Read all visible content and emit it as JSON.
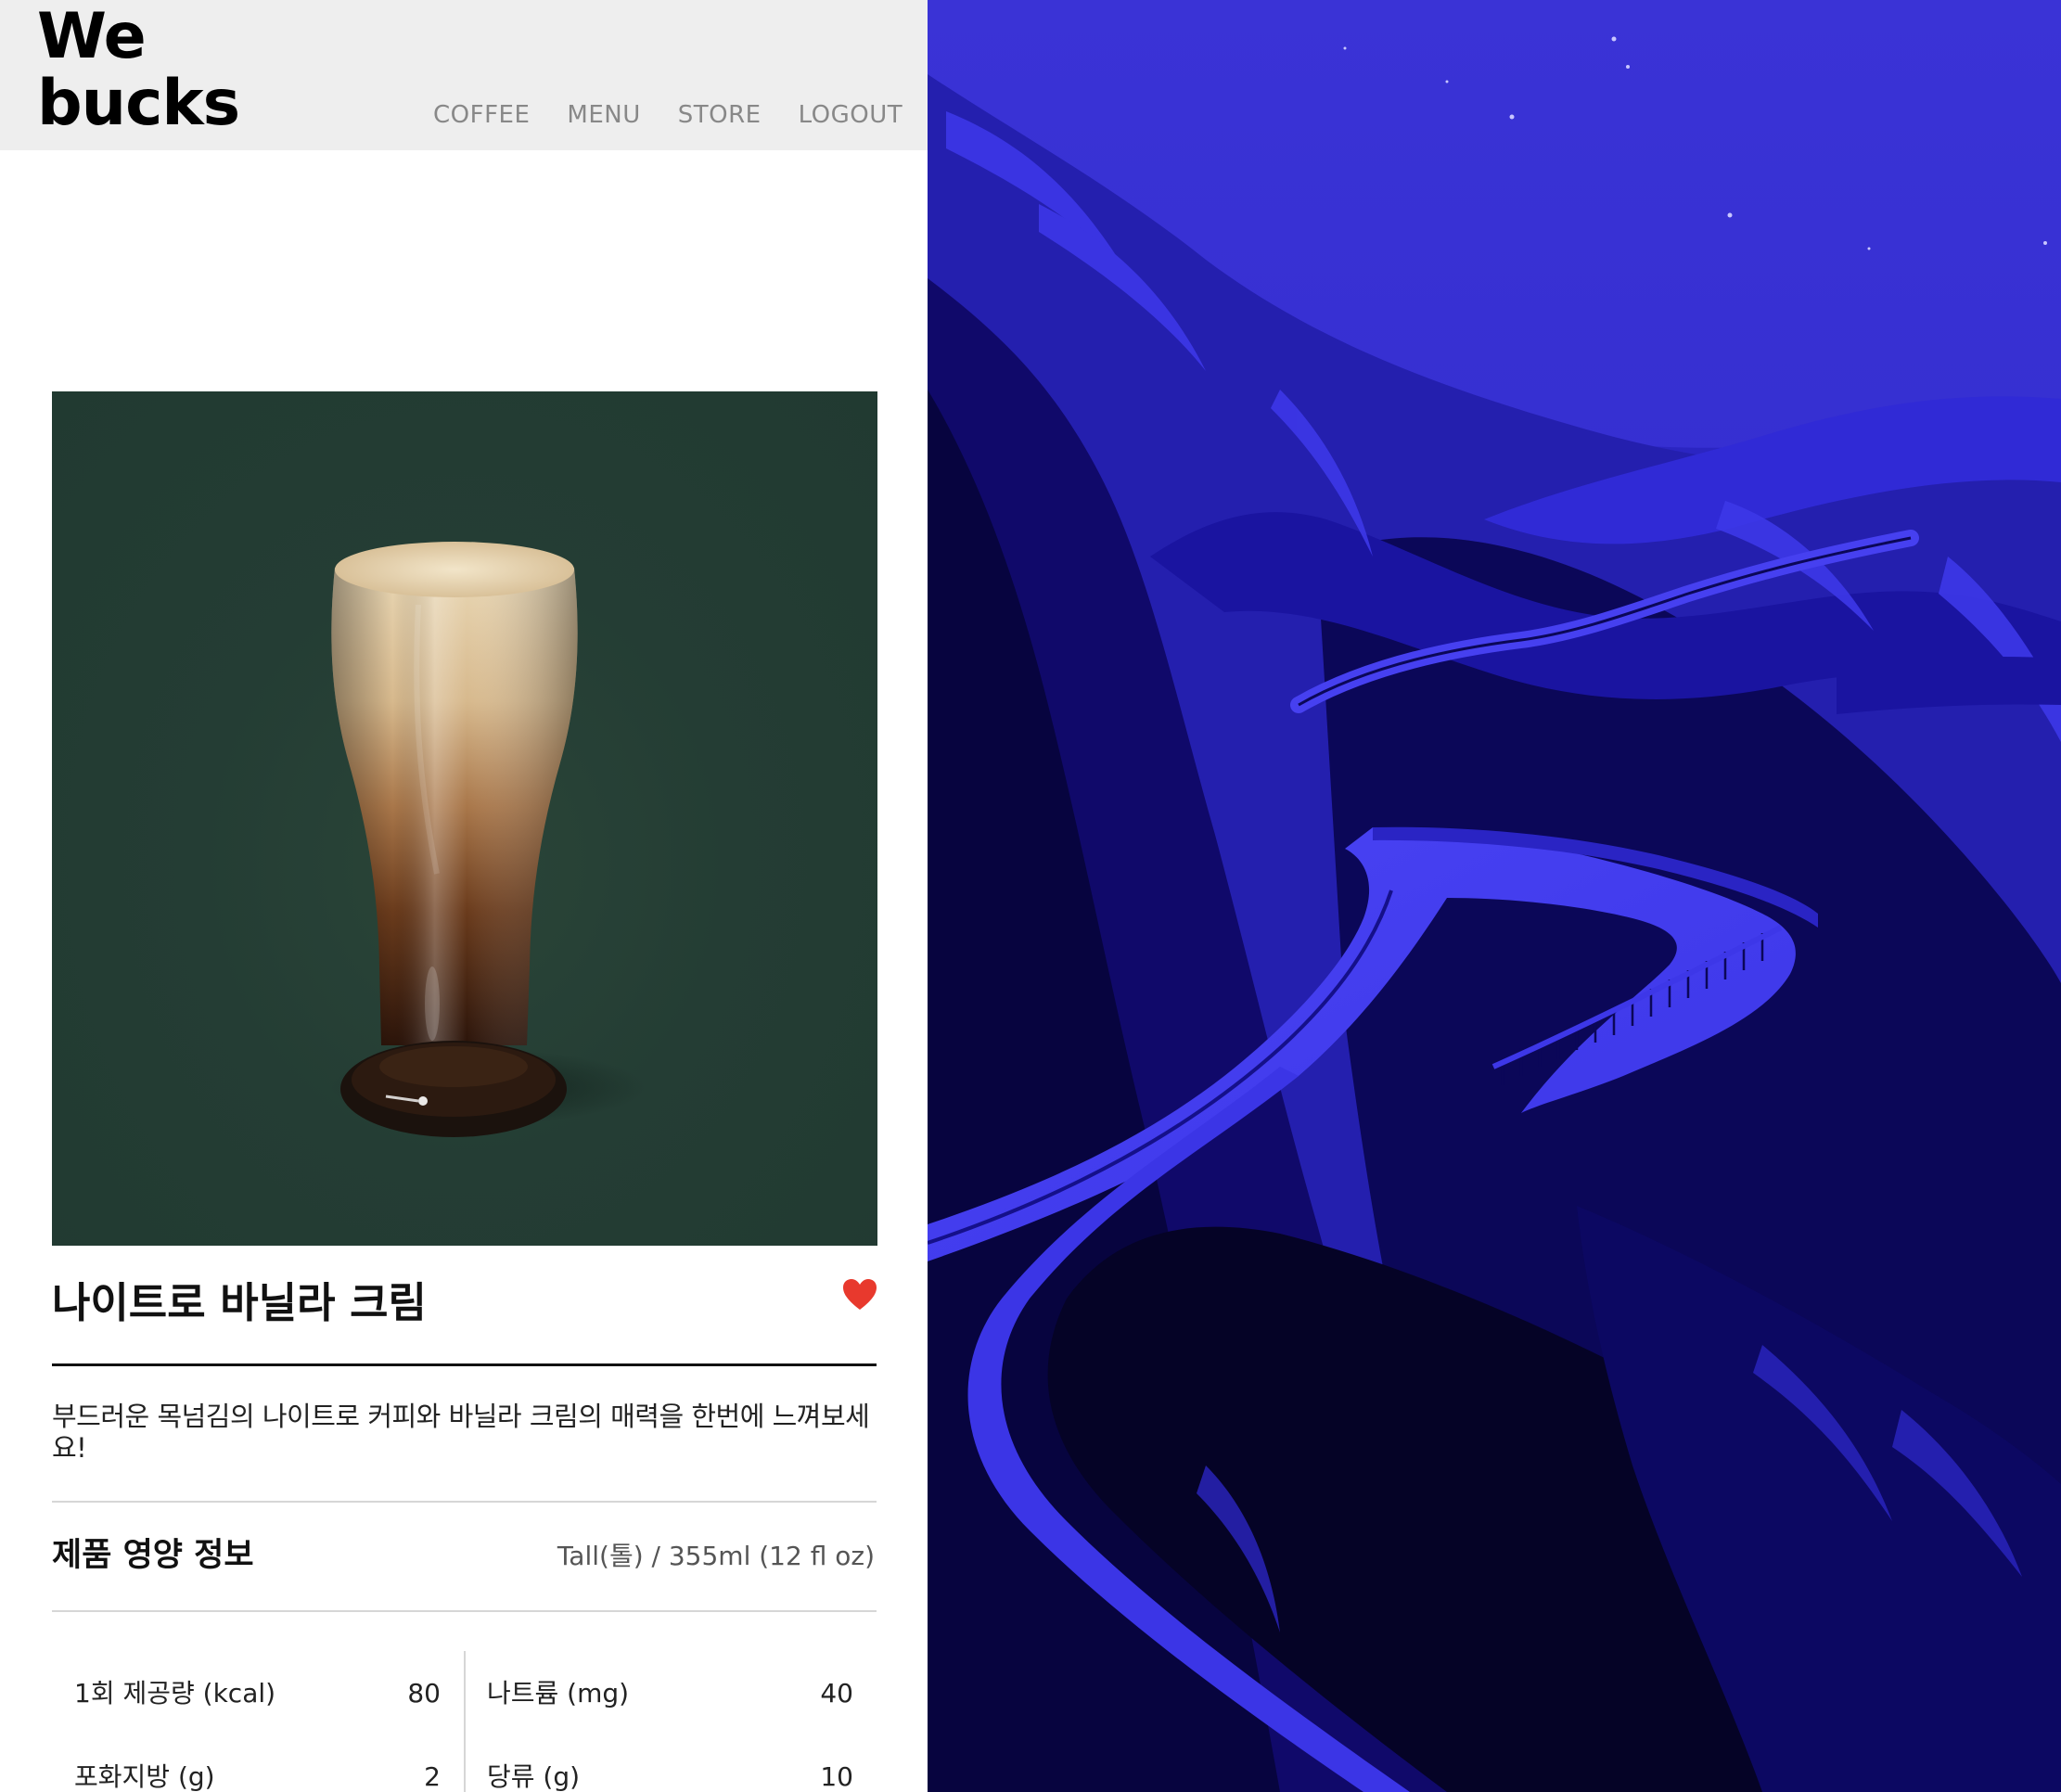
{
  "header": {
    "logo": "We\nbucks",
    "nav": [
      {
        "label": "COFFEE"
      },
      {
        "label": "MENU"
      },
      {
        "label": "STORE"
      },
      {
        "label": "LOGOUT"
      }
    ]
  },
  "product": {
    "name": "나이트로 바닐라 크림",
    "liked": true,
    "description": "부드러운 목넘김의 나이트로 커피와 바닐라 크림의 매력을 한번에 느껴보세요!",
    "image_alt": "nitro vanilla cream glass"
  },
  "nutrition": {
    "heading": "제품 영양 정보",
    "serving": "Tall(톨) / 355ml (12 fl oz)",
    "items": [
      {
        "label": "1회 제공량 (kcal)",
        "value": "80"
      },
      {
        "label": "나트륨 (mg)",
        "value": "40"
      },
      {
        "label": "포화지방 (g)",
        "value": "2"
      },
      {
        "label": "당류 (g)",
        "value": "10"
      }
    ]
  },
  "colors": {
    "header_bg": "#eeeeee",
    "product_bg": "#243d34",
    "heart": "#e8392d",
    "wallpaper_sky": "#2f2ad0",
    "wallpaper_dark": "#0a0630",
    "wallpaper_road": "#3d38f0"
  },
  "wallpaper": {
    "subject": "night mountain road illustration"
  }
}
